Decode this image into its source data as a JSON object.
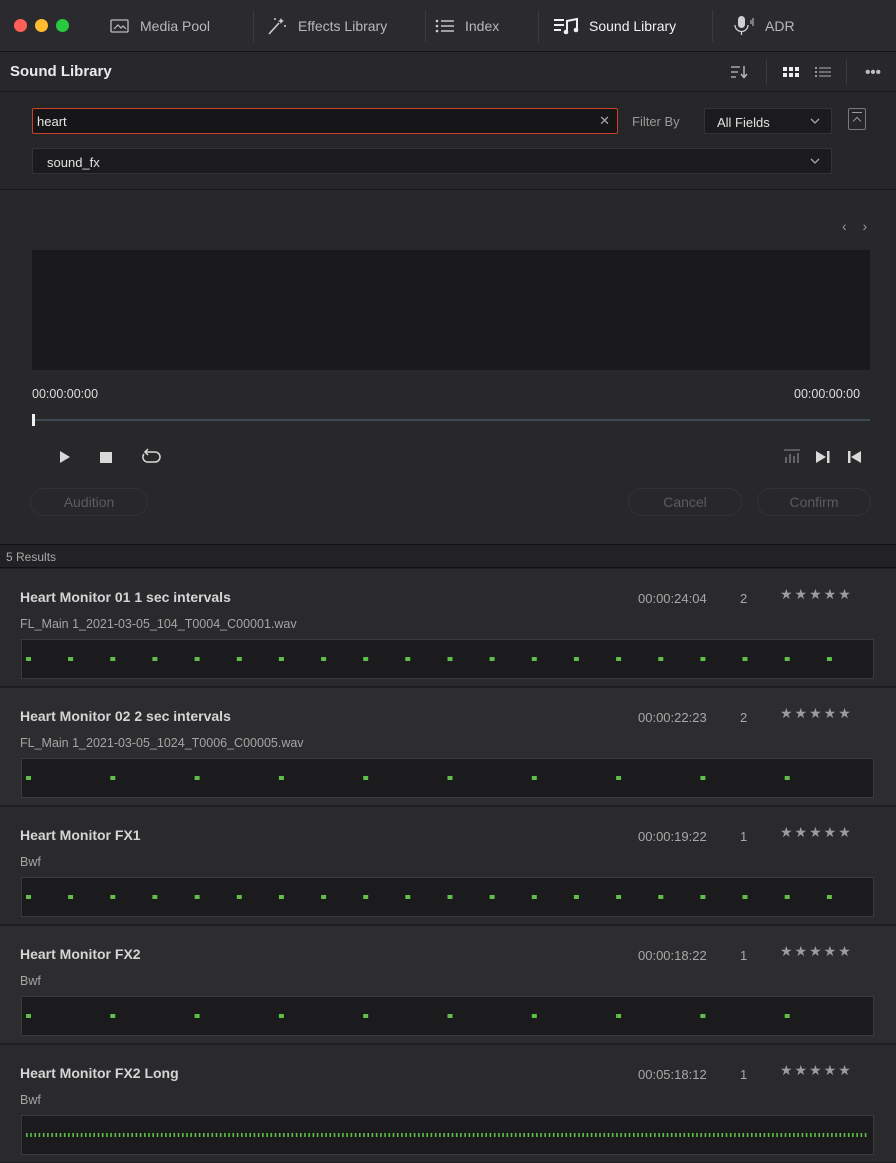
{
  "tabs": [
    {
      "label": "Media Pool",
      "icon": "media-pool-icon"
    },
    {
      "label": "Effects Library",
      "icon": "effects-wand-icon"
    },
    {
      "label": "Index",
      "icon": "index-list-icon"
    },
    {
      "label": "Sound Library",
      "icon": "sound-library-icon",
      "active": true
    },
    {
      "label": "ADR",
      "icon": "microphone-icon"
    }
  ],
  "panel": {
    "title": "Sound Library"
  },
  "search": {
    "value": "heart",
    "filter_label": "Filter By",
    "filter_value": "All Fields",
    "database": "sound_fx"
  },
  "player": {
    "start_tc": "00:00:00:00",
    "end_tc": "00:00:00:00",
    "audition_label": "Audition",
    "cancel_label": "Cancel",
    "confirm_label": "Confirm"
  },
  "results": {
    "count_label": "5 Results",
    "items": [
      {
        "name": "Heart Monitor 01 1 sec intervals",
        "file": "FL_Main 1_2021-03-05_104_T0004_C00001.wav",
        "duration": "00:00:24:04",
        "channels": "2",
        "rating": "★★★★★",
        "beats": 20
      },
      {
        "name": "Heart Monitor 02 2 sec intervals",
        "file": "FL_Main 1_2021-03-05_1024_T0006_C00005.wav",
        "duration": "00:00:22:23",
        "channels": "2",
        "rating": "★★★★★",
        "beats": 10
      },
      {
        "name": "Heart Monitor FX1",
        "file": "Bwf",
        "duration": "00:00:19:22",
        "channels": "1",
        "rating": "★★★★★",
        "beats": 20
      },
      {
        "name": "Heart Monitor FX2",
        "file": "Bwf",
        "duration": "00:00:18:22",
        "channels": "1",
        "rating": "★★★★★",
        "beats": 10
      },
      {
        "name": "Heart Monitor FX2 Long",
        "file": "Bwf",
        "duration": "00:05:18:12",
        "channels": "1",
        "rating": "★★★★★",
        "beats": 200
      }
    ]
  },
  "colors": {
    "waveform": "#5fbf4a",
    "search_focus": "#c8412c"
  }
}
